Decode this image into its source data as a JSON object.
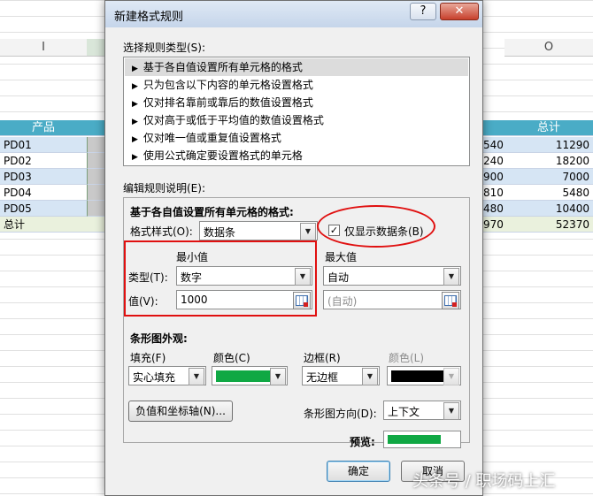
{
  "spreadsheet": {
    "col_left_label": "I",
    "col_right_label": "O",
    "left_header": "产品",
    "right_header": "总计",
    "rows": [
      {
        "name": "PD01",
        "partial": "540",
        "total": "11290"
      },
      {
        "name": "PD02",
        "partial": "240",
        "total": "18200"
      },
      {
        "name": "PD03",
        "partial": "900",
        "total": "7000"
      },
      {
        "name": "PD04",
        "partial": "810",
        "total": "5480"
      },
      {
        "name": "PD05",
        "partial": "480",
        "total": "10400"
      },
      {
        "name": "总计",
        "partial": "970",
        "total": "52370"
      }
    ]
  },
  "dialog": {
    "title": "新建格式规则",
    "help_label": "?",
    "close_label": "✕",
    "rule_type_label": "选择规则类型(S):",
    "rule_types": [
      "基于各自值设置所有单元格的格式",
      "只为包含以下内容的单元格设置格式",
      "仅对排名靠前或靠后的数值设置格式",
      "仅对高于或低于平均值的数值设置格式",
      "仅对唯一值或重复值设置格式",
      "使用公式确定要设置格式的单元格"
    ],
    "arrow_glyph": "▶",
    "edit_label": "编辑规则说明(E):",
    "format_heading": "基于各自值设置所有单元格的格式:",
    "format_style_label": "格式样式(O):",
    "format_style_value": "数据条",
    "show_bar_only_label": "仅显示数据条(B)",
    "show_bar_only_checked": "✓",
    "min_heading": "最小值",
    "max_heading": "最大值",
    "type_label": "类型(T):",
    "value_label": "值(V):",
    "min_type": "数字",
    "max_type": "自动",
    "min_value": "1000",
    "max_value": "(自动)",
    "appearance_heading": "条形图外观:",
    "fill_label": "填充(F)",
    "fill_value": "实心填充",
    "fill_color_label": "颜色(C)",
    "border_label": "边框(R)",
    "border_value": "无边框",
    "border_color_label": "颜色(L)",
    "axis_button": "负值和坐标轴(N)...",
    "direction_label": "条形图方向(D):",
    "direction_value": "上下文",
    "preview_label": "预览:",
    "ok_button": "确定",
    "cancel_button": "取消",
    "dropdown_glyph": "▼"
  },
  "colors": {
    "fill_color": "#10a844",
    "border_color": "#000000",
    "preview_bar": "#10a844",
    "highlight": "#e01010"
  },
  "watermark": "头条号 / 职场码上汇"
}
